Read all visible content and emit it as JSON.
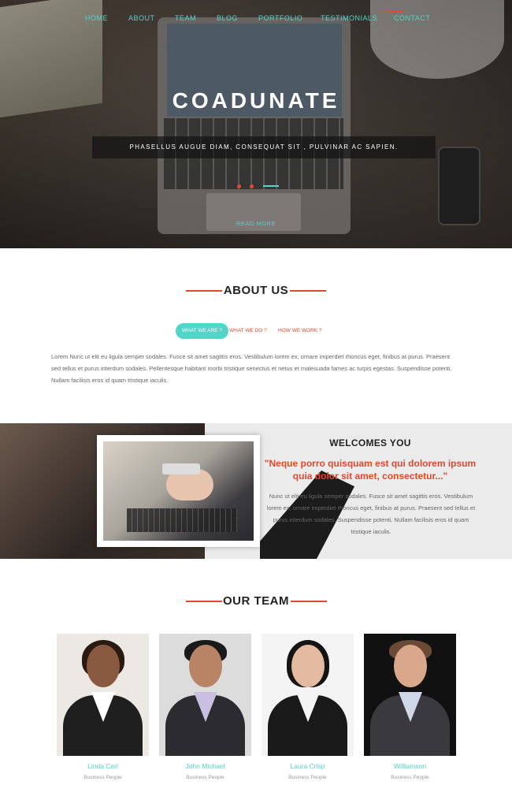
{
  "nav": {
    "items": [
      "HOME",
      "ABOUT",
      "TEAM",
      "BLOG",
      "PORTFOLIO",
      "TESTIMONIALS",
      "CONTACT"
    ],
    "active": "CONTACT",
    "accent": "#4fd6c8",
    "highlight": "#e0492e"
  },
  "hero": {
    "title": "COADUNATE",
    "subtitle": "PHASELLUS AUGUE DIAM, CONSEQUAT SIT , PULVINAR AC SAPIEN.",
    "read_more": "READ MORE"
  },
  "about": {
    "title": "ABOUT US",
    "tabs": [
      "WHAT WE ARE ?",
      "WHAT WE DO ?",
      "HOW WE WORK ?"
    ],
    "active_tab": "WHAT WE ARE ?",
    "text": "Lorem Nunc ut elit eu ligula semper sodales. Fusce sit amet sagittis eros. Vestibulum lorem ex, ornare imperdiet rhoncus eget, finibus at purus. Praesent sed tellus et purus interdum sodales. Pellentesque habitant morbi tristique senectus et netus et malesuada fames ac turpis egestas. Suspendisse potenti. Nullam facilisis eros id quam tristique iaculis."
  },
  "welcome": {
    "title": "WELCOMES YOU",
    "quote": "\"Neque porro quisquam est qui dolorem ipsum quia dolor sit amet, consectetur...\"",
    "text": "Nunc ut elit eu ligula semper sodales. Fusce sit amet sagittis eros. Vestibulum lorem ex, ornare imperdiet rhoncus eget, finibus at purus. Praesent sed tellus et purus interdum sodales. Suspendisse potenti. Nullam facilisis eros id quam tristique iaculis."
  },
  "team": {
    "title": "OUR TEAM",
    "members": [
      {
        "name": "Linda Carl",
        "role": "Business People"
      },
      {
        "name": "John Michael",
        "role": "Business People"
      },
      {
        "name": "Laura Crisp",
        "role": "Business People"
      },
      {
        "name": "Williamson",
        "role": "Business People"
      }
    ]
  }
}
